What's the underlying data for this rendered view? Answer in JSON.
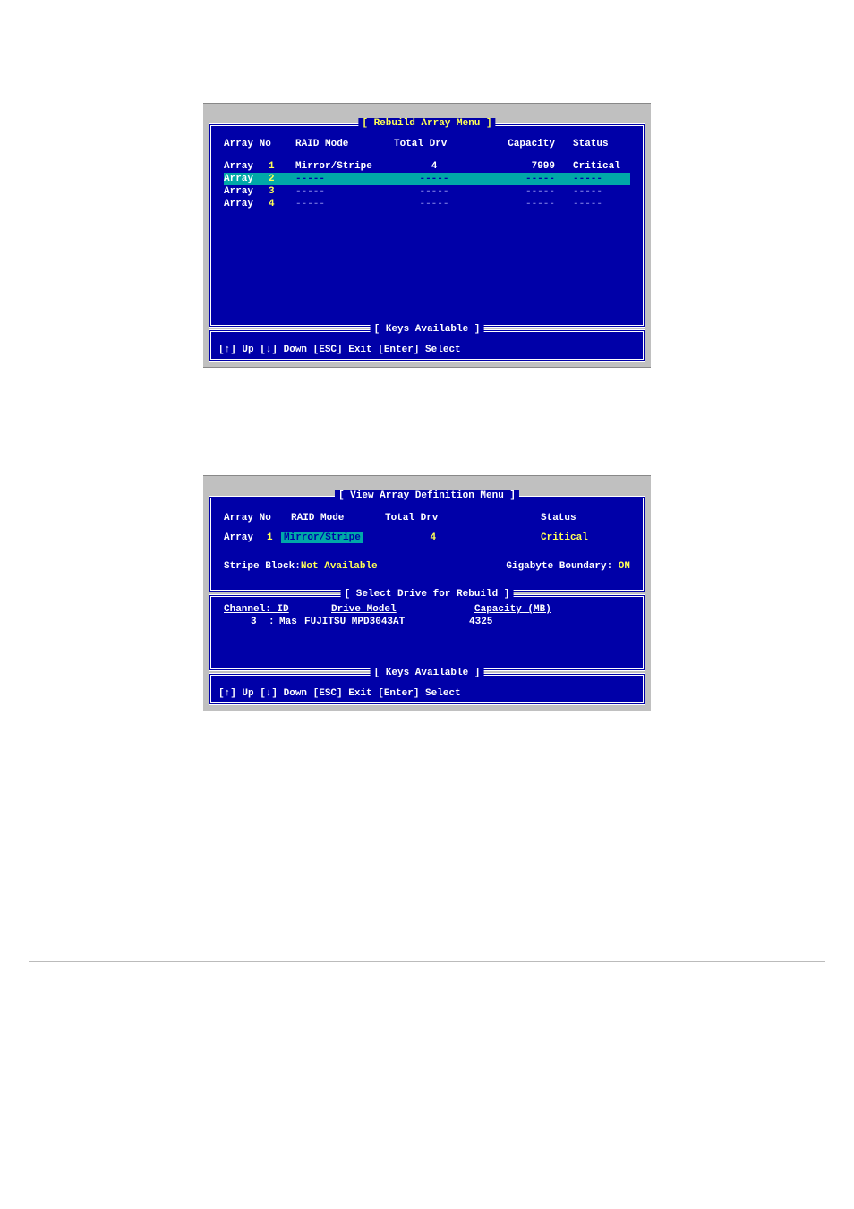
{
  "screen1": {
    "title": "[ Rebuild Array Menu ]",
    "headers": {
      "array_no": "Array No",
      "raid_mode": "RAID Mode",
      "total_drv": "Total Drv",
      "capacity": "Capacity",
      "status": "Status"
    },
    "rows": [
      {
        "label": "Array",
        "num": "1",
        "raid_mode": "Mirror/Stripe",
        "total_drv": "4",
        "capacity": "7999",
        "status": "Critical"
      },
      {
        "label": "Array",
        "num": "2",
        "raid_mode": "-----",
        "total_drv": "-----",
        "capacity": "-----",
        "status": "-----"
      },
      {
        "label": "Array",
        "num": "3",
        "raid_mode": "-----",
        "total_drv": "-----",
        "capacity": "-----",
        "status": "-----"
      },
      {
        "label": "Array",
        "num": "4",
        "raid_mode": "-----",
        "total_drv": "-----",
        "capacity": "-----",
        "status": "-----"
      }
    ],
    "keys_title": "[ Keys Available ]",
    "keys_text": "[↑] Up  [↓] Down  [ESC] Exit  [Enter] Select"
  },
  "screen2": {
    "title": "[ View Array Definition Menu ]",
    "headers": {
      "array_no": "Array No",
      "raid_mode": "RAID Mode",
      "total_drv": "Total Drv",
      "status": "Status"
    },
    "row": {
      "label": "Array",
      "num": "1",
      "raid_mode": "Mirror/Stripe",
      "total_drv": "4",
      "status": "Critical"
    },
    "stripe_block_label": "Stripe Block: ",
    "stripe_block_value": "Not Available",
    "gig_boundary_label": "Gigabyte Boundary: ",
    "gig_boundary_value": "ON",
    "drive_panel_title": "[ Select Drive for Rebuild ]",
    "drive_headers": {
      "channel_id": "Channel: ID",
      "drive_model": "Drive Model",
      "capacity_mb": "Capacity (MB)"
    },
    "drive_row": {
      "channel": "3",
      "colon": ":",
      "master": "Mas",
      "model": "FUJITSU MPD3043AT",
      "capacity": "4325"
    },
    "keys_title": "[ Keys Available ]",
    "keys_text": "[↑] Up  [↓] Down  [ESC] Exit  [Enter] Select"
  }
}
